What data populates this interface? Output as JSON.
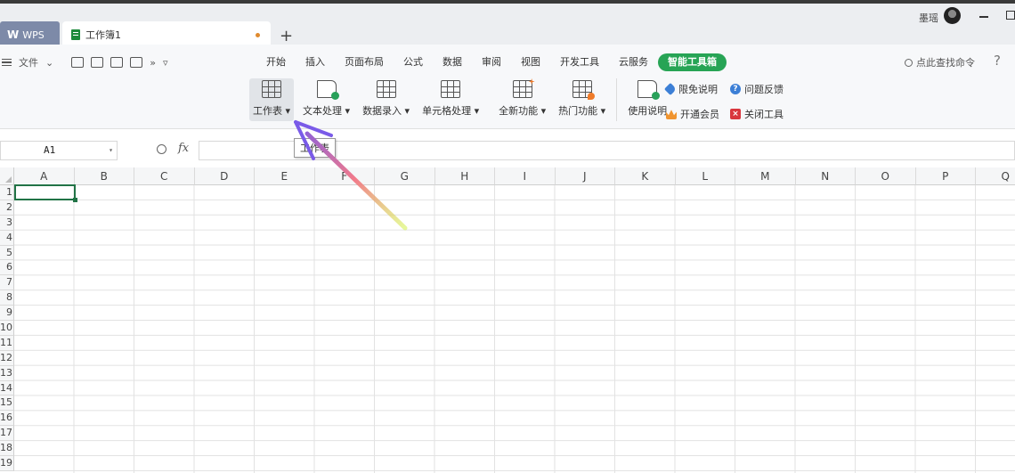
{
  "titlebar": {
    "wps_label": "WPS",
    "doc_tab_label": "工作簿1",
    "new_tab": "+",
    "user_name": "墨瑶"
  },
  "menu": {
    "file_label": "文件",
    "more": "»"
  },
  "tabs": [
    {
      "label": "开始"
    },
    {
      "label": "插入"
    },
    {
      "label": "页面布局"
    },
    {
      "label": "公式"
    },
    {
      "label": "数据"
    },
    {
      "label": "审阅"
    },
    {
      "label": "视图"
    },
    {
      "label": "开发工具"
    },
    {
      "label": "云服务"
    },
    {
      "label": "智能工具箱",
      "active": true
    }
  ],
  "search_command": "点此查找命令",
  "help": "?",
  "toolbox_groups": [
    {
      "label": "工作表 ▾"
    },
    {
      "label": "文本处理 ▾"
    },
    {
      "label": "数据录入 ▾"
    },
    {
      "label": "单元格处理 ▾"
    },
    {
      "label": "全新功能 ▾"
    },
    {
      "label": "热门功能 ▾"
    },
    {
      "label": "使用说明"
    }
  ],
  "side_links": {
    "disclaimer": "限免说明",
    "feedback": "问题反馈",
    "vip": "开通会员",
    "close_tool": "关闭工具"
  },
  "formula_bar": {
    "name_box": "A1",
    "fx": "fx",
    "formula": ""
  },
  "tooltip": "工作表",
  "columns": [
    "A",
    "B",
    "C",
    "D",
    "E",
    "F",
    "G",
    "H",
    "I",
    "J",
    "K",
    "L",
    "M",
    "N",
    "O",
    "P",
    "Q"
  ],
  "rows": [
    "1",
    "2",
    "3",
    "4",
    "5",
    "6",
    "7",
    "8",
    "9",
    "10",
    "11",
    "12",
    "13",
    "14",
    "15",
    "16",
    "17",
    "18",
    "19"
  ],
  "colors": {
    "accent_green": "#27a455",
    "wps_tab": "#7d8aa8",
    "active_cell": "#217346"
  }
}
